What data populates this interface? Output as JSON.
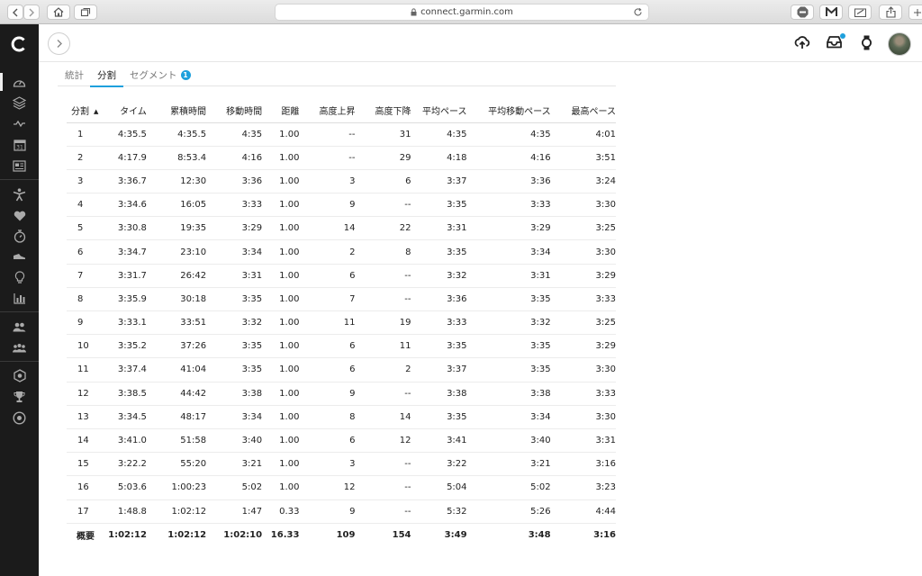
{
  "browser": {
    "url": "connect.garmin.com"
  },
  "tabs": [
    {
      "label": "統計",
      "active": false
    },
    {
      "label": "分割",
      "active": true
    },
    {
      "label": "セグメント",
      "active": false,
      "badge": "1"
    }
  ],
  "table": {
    "headers": [
      "分割",
      "タイム",
      "累積時間",
      "移動時間",
      "距離",
      "高度上昇",
      "高度下降",
      "平均ペース",
      "平均移動ペース",
      "最高ペース"
    ],
    "sort_indicator": "▲",
    "rows": [
      [
        "1",
        "4:35.5",
        "4:35.5",
        "4:35",
        "1.00",
        "--",
        "31",
        "4:35",
        "4:35",
        "4:01"
      ],
      [
        "2",
        "4:17.9",
        "8:53.4",
        "4:16",
        "1.00",
        "--",
        "29",
        "4:18",
        "4:16",
        "3:51"
      ],
      [
        "3",
        "3:36.7",
        "12:30",
        "3:36",
        "1.00",
        "3",
        "6",
        "3:37",
        "3:36",
        "3:24"
      ],
      [
        "4",
        "3:34.6",
        "16:05",
        "3:33",
        "1.00",
        "9",
        "--",
        "3:35",
        "3:33",
        "3:30"
      ],
      [
        "5",
        "3:30.8",
        "19:35",
        "3:29",
        "1.00",
        "14",
        "22",
        "3:31",
        "3:29",
        "3:25"
      ],
      [
        "6",
        "3:34.7",
        "23:10",
        "3:34",
        "1.00",
        "2",
        "8",
        "3:35",
        "3:34",
        "3:30"
      ],
      [
        "7",
        "3:31.7",
        "26:42",
        "3:31",
        "1.00",
        "6",
        "--",
        "3:32",
        "3:31",
        "3:29"
      ],
      [
        "8",
        "3:35.9",
        "30:18",
        "3:35",
        "1.00",
        "7",
        "--",
        "3:36",
        "3:35",
        "3:33"
      ],
      [
        "9",
        "3:33.1",
        "33:51",
        "3:32",
        "1.00",
        "11",
        "19",
        "3:33",
        "3:32",
        "3:25"
      ],
      [
        "10",
        "3:35.2",
        "37:26",
        "3:35",
        "1.00",
        "6",
        "11",
        "3:35",
        "3:35",
        "3:29"
      ],
      [
        "11",
        "3:37.4",
        "41:04",
        "3:35",
        "1.00",
        "6",
        "2",
        "3:37",
        "3:35",
        "3:30"
      ],
      [
        "12",
        "3:38.5",
        "44:42",
        "3:38",
        "1.00",
        "9",
        "--",
        "3:38",
        "3:38",
        "3:33"
      ],
      [
        "13",
        "3:34.5",
        "48:17",
        "3:34",
        "1.00",
        "8",
        "14",
        "3:35",
        "3:34",
        "3:30"
      ],
      [
        "14",
        "3:41.0",
        "51:58",
        "3:40",
        "1.00",
        "6",
        "12",
        "3:41",
        "3:40",
        "3:31"
      ],
      [
        "15",
        "3:22.2",
        "55:20",
        "3:21",
        "1.00",
        "3",
        "--",
        "3:22",
        "3:21",
        "3:16"
      ],
      [
        "16",
        "5:03.6",
        "1:00:23",
        "5:02",
        "1.00",
        "12",
        "--",
        "5:04",
        "5:02",
        "3:23"
      ],
      [
        "17",
        "1:48.8",
        "1:02:12",
        "1:47",
        "0.33",
        "9",
        "--",
        "5:32",
        "5:26",
        "4:44"
      ]
    ],
    "total": [
      "概要",
      "1:02:12",
      "1:02:12",
      "1:02:10",
      "16.33",
      "109",
      "154",
      "3:49",
      "3:48",
      "3:16"
    ]
  },
  "colors": {
    "accent": "#1ea0dc",
    "sidebar": "#1b1b1b"
  }
}
